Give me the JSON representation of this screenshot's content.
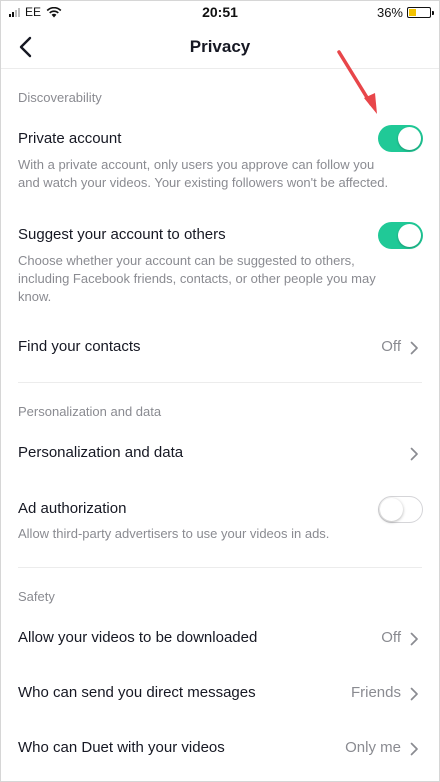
{
  "status_bar": {
    "carrier": "EE",
    "time": "20:51",
    "battery": "36%",
    "icons": [
      "signal-icon",
      "wifi-icon",
      "battery-icon"
    ]
  },
  "header": {
    "title": "Privacy",
    "back_icon": "chevron-left-icon"
  },
  "discoverability": {
    "header": "Discoverability",
    "private_account": {
      "label": "Private account",
      "description": "With a private account, only users you approve can follow you and watch your videos. Your existing followers won't be affected.",
      "enabled": true
    },
    "suggest_account": {
      "label": "Suggest your account to others",
      "description": "Choose whether your account can be suggested to others, including Facebook friends, contacts, or other people you may know.",
      "enabled": true
    },
    "find_contacts": {
      "label": "Find your contacts",
      "value": "Off"
    }
  },
  "personalization": {
    "header": "Personalization and data",
    "personalization_data": {
      "label": "Personalization and data"
    },
    "ad_authorization": {
      "label": "Ad authorization",
      "description": "Allow third-party advertisers to use your videos in ads.",
      "enabled": false
    }
  },
  "safety": {
    "header": "Safety",
    "downloads": {
      "label": "Allow your videos to be downloaded",
      "value": "Off"
    },
    "direct_messages": {
      "label": "Who can send you direct messages",
      "value": "Friends"
    },
    "duet": {
      "label": "Who can Duet with your videos",
      "value": "Only me"
    }
  },
  "colors": {
    "toggle_on": "#20c997",
    "annotation_arrow": "#e8464a",
    "secondary_text": "#8a8b91"
  }
}
